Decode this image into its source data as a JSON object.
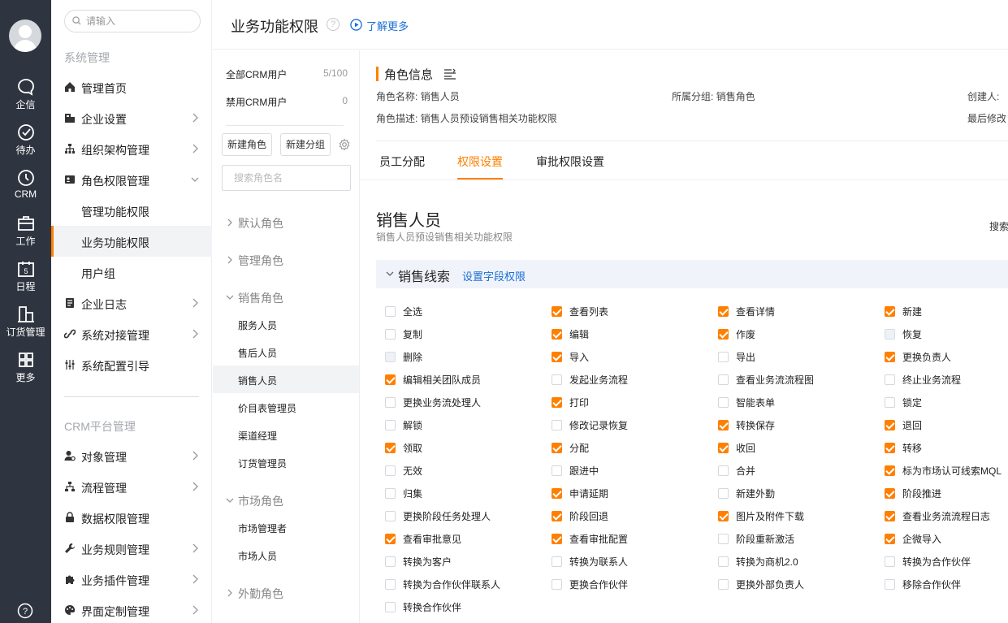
{
  "rail": {
    "items": [
      {
        "label": "企信",
        "icon": "chat-bubble-icon"
      },
      {
        "label": "待办",
        "icon": "check-circle-icon"
      },
      {
        "label": "CRM",
        "icon": "clock-icon"
      },
      {
        "label": "工作",
        "icon": "briefcase-icon"
      },
      {
        "label": "日程",
        "icon": "calendar-icon"
      },
      {
        "label": "订货管理",
        "icon": "building-icon"
      },
      {
        "label": "更多",
        "icon": "grid-icon"
      }
    ],
    "calendar_day": "5",
    "help_label": "?"
  },
  "sidebar": {
    "search_placeholder": "请输入",
    "section1_title": "系统管理",
    "items": [
      {
        "label": "管理首页",
        "icon": "home-icon"
      },
      {
        "label": "企业设置",
        "icon": "company-icon"
      },
      {
        "label": "组织架构管理",
        "icon": "org-chart-icon"
      },
      {
        "label": "角色权限管理",
        "icon": "role-card-icon"
      },
      {
        "label": "管理功能权限"
      },
      {
        "label": "业务功能权限"
      },
      {
        "label": "用户组"
      },
      {
        "label": "企业日志",
        "icon": "log-icon"
      },
      {
        "label": "系统对接管理",
        "icon": "link-icon"
      },
      {
        "label": "系统配置引导",
        "icon": "sliders-icon"
      }
    ],
    "section2_title": "CRM平台管理",
    "items2": [
      {
        "label": "对象管理",
        "icon": "user-gear-icon"
      },
      {
        "label": "流程管理",
        "icon": "flow-icon"
      },
      {
        "label": "数据权限管理",
        "icon": "lock-icon"
      },
      {
        "label": "业务规则管理",
        "icon": "wrench-icon"
      },
      {
        "label": "业务插件管理",
        "icon": "puzzle-icon"
      },
      {
        "label": "界面定制管理",
        "icon": "palette-icon"
      }
    ]
  },
  "header": {
    "title": "业务功能权限",
    "help": "?",
    "learn_more": "了解更多"
  },
  "roles": {
    "stats": [
      {
        "label": "全部CRM用户",
        "value": "5/100"
      },
      {
        "label": "禁用CRM用户",
        "value": "0"
      }
    ],
    "new_role": "新建角色",
    "new_group": "新建分组",
    "search_placeholder": "搜索角色名",
    "groups": {
      "default": "默认角色",
      "admin": "管理角色",
      "sales": "销售角色",
      "market": "市场角色",
      "field": "外勤角色"
    },
    "sales_roles": [
      "服务人员",
      "售后人员",
      "销售人员",
      "价目表管理员",
      "渠道经理",
      "订货管理员"
    ],
    "market_roles": [
      "市场管理者",
      "市场人员"
    ]
  },
  "info": {
    "title": "角色信息",
    "name_label": "角色名称:",
    "name_value": "销售人员",
    "group_label": "所属分组:",
    "group_value": "销售角色",
    "creator_label": "创建人:",
    "desc_label": "角色描述:",
    "desc_value": "销售人员预设销售相关功能权限",
    "modified_label": "最后修改"
  },
  "tabs": [
    "员工分配",
    "权限设置",
    "审批权限设置"
  ],
  "role_header": {
    "name": "销售人员",
    "desc": "销售人员预设销售相关功能权限",
    "search": "搜索"
  },
  "module": {
    "title": "销售线索",
    "link": "设置字段权限"
  },
  "permissions": [
    {
      "label": "全选",
      "state": "off"
    },
    {
      "label": "查看列表",
      "state": "on"
    },
    {
      "label": "查看详情",
      "state": "on"
    },
    {
      "label": "新建",
      "state": "on"
    },
    {
      "label": "复制",
      "state": "off"
    },
    {
      "label": "编辑",
      "state": "on"
    },
    {
      "label": "作废",
      "state": "on"
    },
    {
      "label": "恢复",
      "state": "dis"
    },
    {
      "label": "删除",
      "state": "dis"
    },
    {
      "label": "导入",
      "state": "on"
    },
    {
      "label": "导出",
      "state": "off"
    },
    {
      "label": "更换负责人",
      "state": "on"
    },
    {
      "label": "编辑相关团队成员",
      "state": "on"
    },
    {
      "label": "发起业务流程",
      "state": "off"
    },
    {
      "label": "查看业务流流程图",
      "state": "off"
    },
    {
      "label": "终止业务流程",
      "state": "off"
    },
    {
      "label": "更换业务流处理人",
      "state": "off"
    },
    {
      "label": "打印",
      "state": "on"
    },
    {
      "label": "智能表单",
      "state": "off"
    },
    {
      "label": "锁定",
      "state": "off"
    },
    {
      "label": "解锁",
      "state": "off"
    },
    {
      "label": "修改记录恢复",
      "state": "off"
    },
    {
      "label": "转换保存",
      "state": "on"
    },
    {
      "label": "退回",
      "state": "on"
    },
    {
      "label": "领取",
      "state": "on"
    },
    {
      "label": "分配",
      "state": "on"
    },
    {
      "label": "收回",
      "state": "on"
    },
    {
      "label": "转移",
      "state": "on"
    },
    {
      "label": "无效",
      "state": "off"
    },
    {
      "label": "跟进中",
      "state": "off"
    },
    {
      "label": "合并",
      "state": "off"
    },
    {
      "label": "标为市场认可线索MQL",
      "state": "on"
    },
    {
      "label": "归集",
      "state": "off"
    },
    {
      "label": "申请延期",
      "state": "on"
    },
    {
      "label": "新建外勤",
      "state": "off"
    },
    {
      "label": "阶段推进",
      "state": "on"
    },
    {
      "label": "更换阶段任务处理人",
      "state": "off"
    },
    {
      "label": "阶段回退",
      "state": "on"
    },
    {
      "label": "图片及附件下载",
      "state": "on"
    },
    {
      "label": "查看业务流流程日志",
      "state": "on"
    },
    {
      "label": "查看审批意见",
      "state": "on"
    },
    {
      "label": "查看审批配置",
      "state": "on"
    },
    {
      "label": "阶段重新激活",
      "state": "off"
    },
    {
      "label": "企微导入",
      "state": "on"
    },
    {
      "label": "转换为客户",
      "state": "off"
    },
    {
      "label": "转换为联系人",
      "state": "off"
    },
    {
      "label": "转换为商机2.0",
      "state": "off"
    },
    {
      "label": "转换为合作伙伴",
      "state": "off"
    },
    {
      "label": "转换为合作伙伴联系人",
      "state": "off"
    },
    {
      "label": "更换合作伙伴",
      "state": "off"
    },
    {
      "label": "更换外部负责人",
      "state": "off"
    },
    {
      "label": "移除合作伙伴",
      "state": "off"
    },
    {
      "label": "转换合作伙伴",
      "state": "off"
    }
  ],
  "colors": {
    "accent": "#ff8000",
    "link": "#1b6fd6",
    "rail": "#2f3540"
  }
}
